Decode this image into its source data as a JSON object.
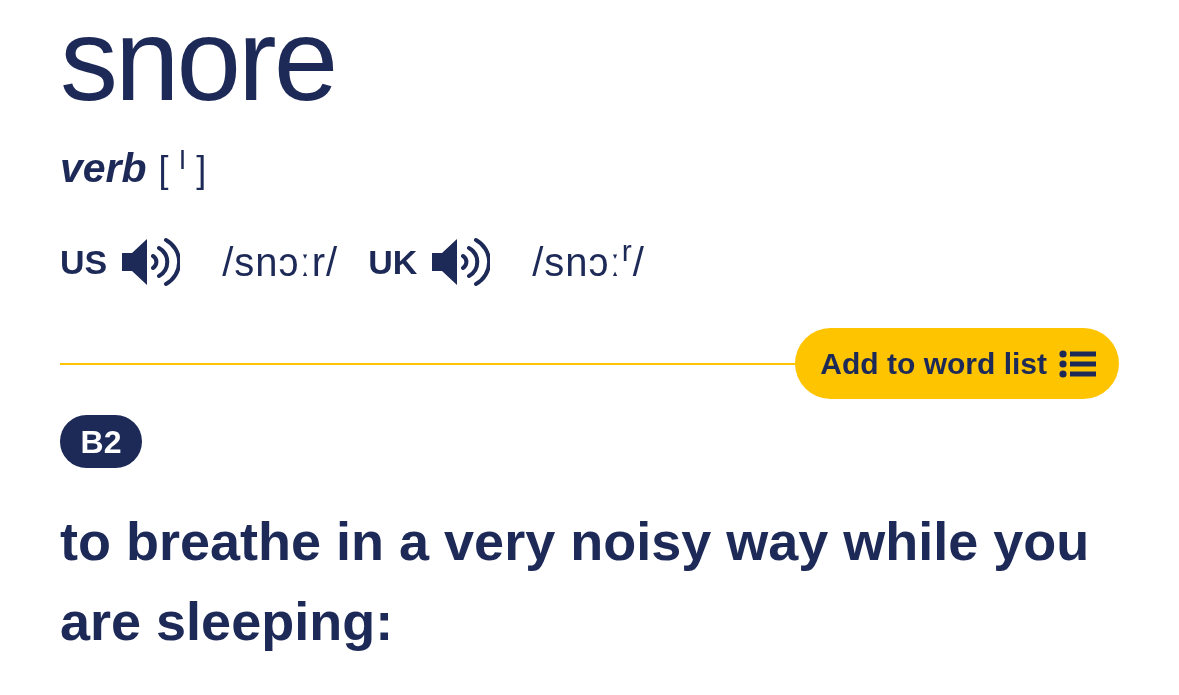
{
  "entry": {
    "headword": "snore",
    "part_of_speech": "verb",
    "grammar": "[ $^{I}$ ]"
  },
  "pronunciations": [
    {
      "region": "US",
      "ipa": "/snɔːr/"
    },
    {
      "region": "UK",
      "ipa": "/snɔː$^{r}$/"
    }
  ],
  "word_list_button": {
    "label": "Add to word list"
  },
  "sense": {
    "cefr": "B2",
    "definition": "to breathe in a very noisy way while you are sleeping:"
  }
}
